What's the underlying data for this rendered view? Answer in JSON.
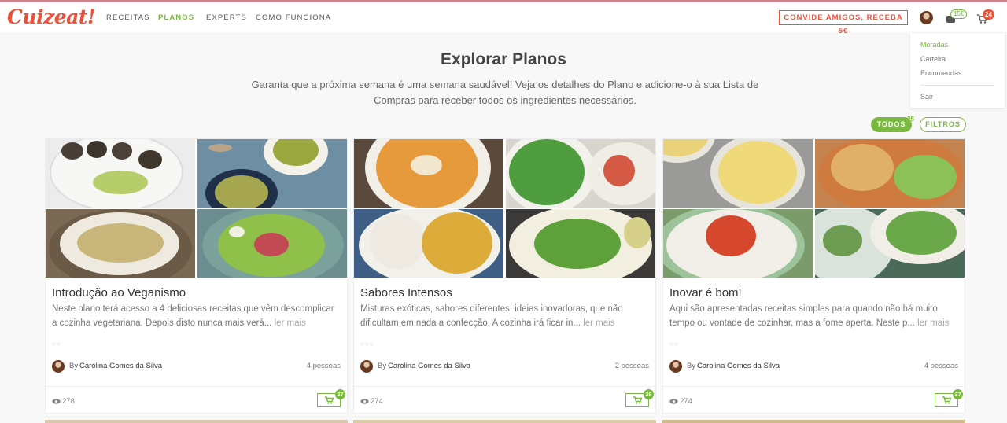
{
  "brand": {
    "logo_text": "Cuizeat!"
  },
  "nav": {
    "links": [
      {
        "label": "RECEITAS",
        "active": false
      },
      {
        "label": "PLANOS",
        "active": true
      },
      {
        "label": "EXPERTS",
        "active": false
      },
      {
        "label": "COMO FUNCIONA",
        "active": false
      }
    ],
    "invite_label": "CONVIDE AMIGOS, RECEBA 5€",
    "wallet_badge": "15€",
    "cart_badge": "24"
  },
  "user_menu": {
    "items": [
      {
        "label": "Moradas",
        "active": true
      },
      {
        "label": "Carteira",
        "active": false
      },
      {
        "label": "Encomendas",
        "active": false
      },
      {
        "label": "Sair",
        "active": false
      }
    ]
  },
  "header": {
    "title": "Explorar Planos",
    "subtitle": "Garanta que a próxima semana é uma semana saudável! Veja os detalhes do Plano e adicione-o à sua Lista de Compras para receber todos os ingredientes necessários."
  },
  "filters": {
    "todos_label": "TODOS",
    "todos_count": "25",
    "filtros_label": "FILTROS"
  },
  "accent_colors": {
    "brand": "#e8533a",
    "green": "#7ab93f"
  },
  "cards": [
    {
      "title": "Introdução ao Veganismo",
      "description": "Neste plano terá acesso a 4 deliciosas receitas que vêm descomplicar a cozinha vegetariana. Depois disto nunca mais verá...",
      "read_more": "ler mais",
      "dots": "○○",
      "by": "By",
      "author": "Carolina Gomes da Silva",
      "people": "4 pessoas",
      "views": "278",
      "cart_count": "27"
    },
    {
      "title": "Sabores Intensos",
      "description": "Misturas exóticas, sabores diferentes, ideias inovadoras, que não dificultam em nada a confecção. A cozinha irá ficar in...",
      "read_more": "ler mais",
      "dots": "○○○",
      "by": "By",
      "author": "Carolina Gomes da Silva",
      "people": "2 pessoas",
      "views": "274",
      "cart_count": "26"
    },
    {
      "title": "Inovar é bom!",
      "description": "Aqui são apresentadas receitas simples para quando não há muito tempo ou vontade de cozinhar, mas a fome aperta. Neste p...",
      "read_more": "ler mais",
      "dots": "○○",
      "by": "By",
      "author": "Carolina Gomes da Silva",
      "people": "4 pessoas",
      "views": "274",
      "cart_count": "37"
    }
  ]
}
